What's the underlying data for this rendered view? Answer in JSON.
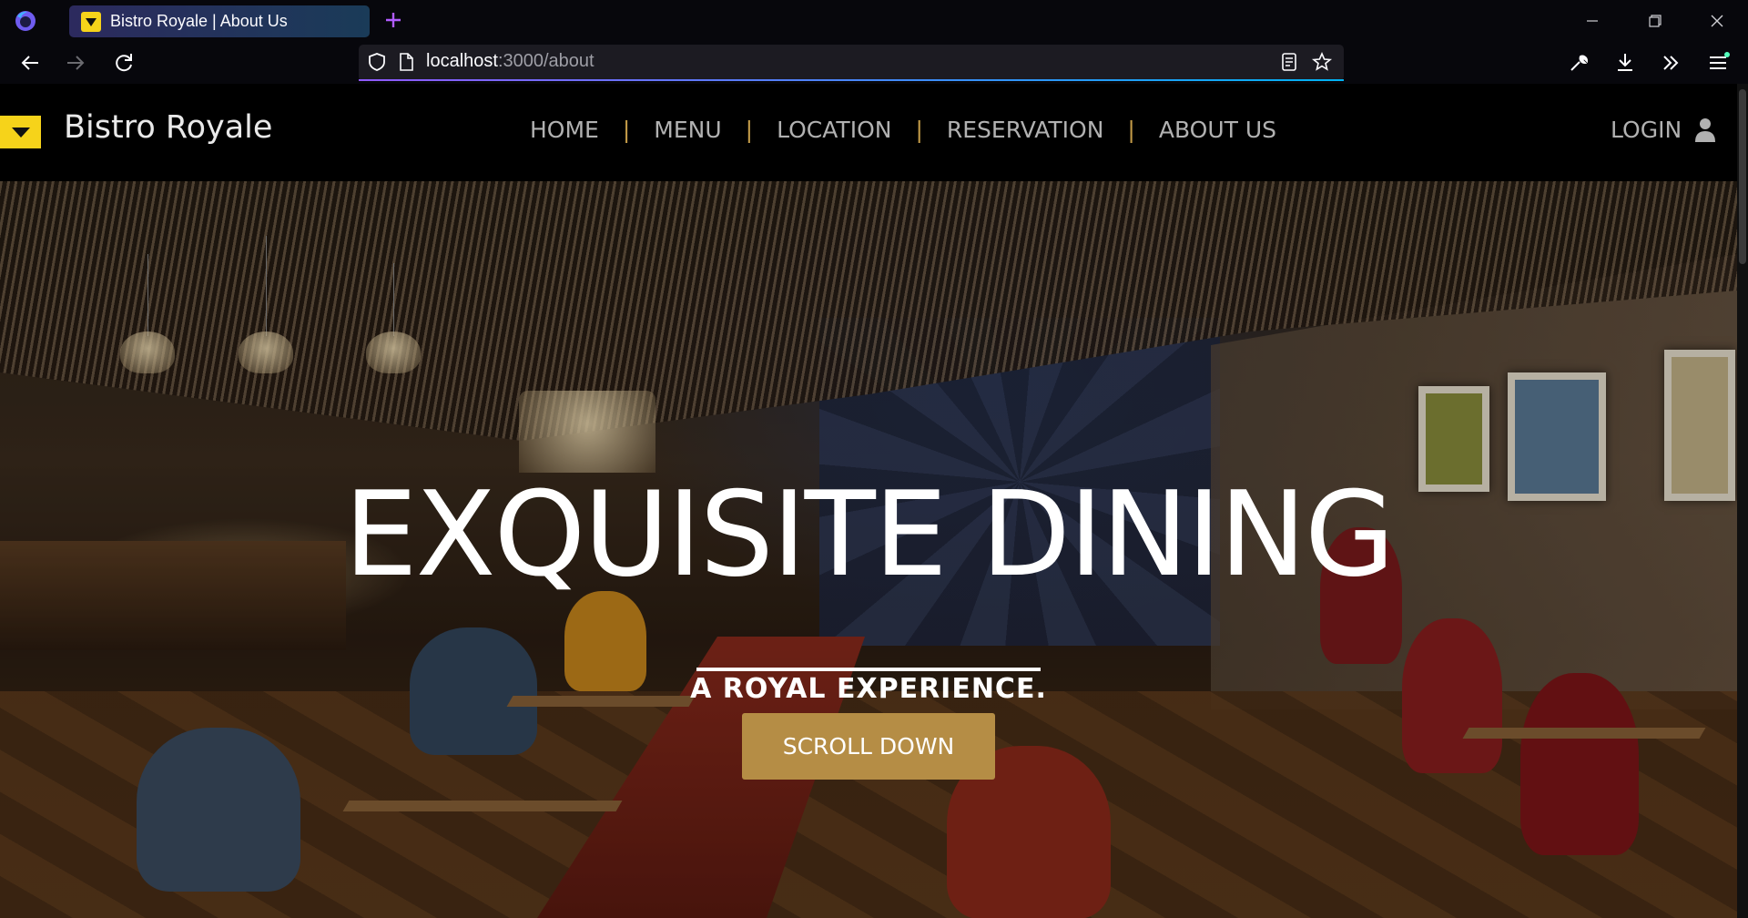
{
  "browser": {
    "tab_title": "Bistro Royale | About Us",
    "url_host": "localhost",
    "url_rest": ":3000/about",
    "accent": "#9059ff"
  },
  "site": {
    "brand_name": "Bistro Royale",
    "brand_color": "#f6d31a",
    "nav": [
      {
        "label": "HOME"
      },
      {
        "label": "MENU"
      },
      {
        "label": "LOCATION"
      },
      {
        "label": "RESERVATION"
      },
      {
        "label": "ABOUT US"
      }
    ],
    "separator": "|",
    "login_label": "LOGIN"
  },
  "hero": {
    "title": "EXQUISITE DINING",
    "subtitle": "A ROYAL EXPERIENCE.",
    "button_label": "SCROLL DOWN",
    "button_color": "#b58d45"
  }
}
